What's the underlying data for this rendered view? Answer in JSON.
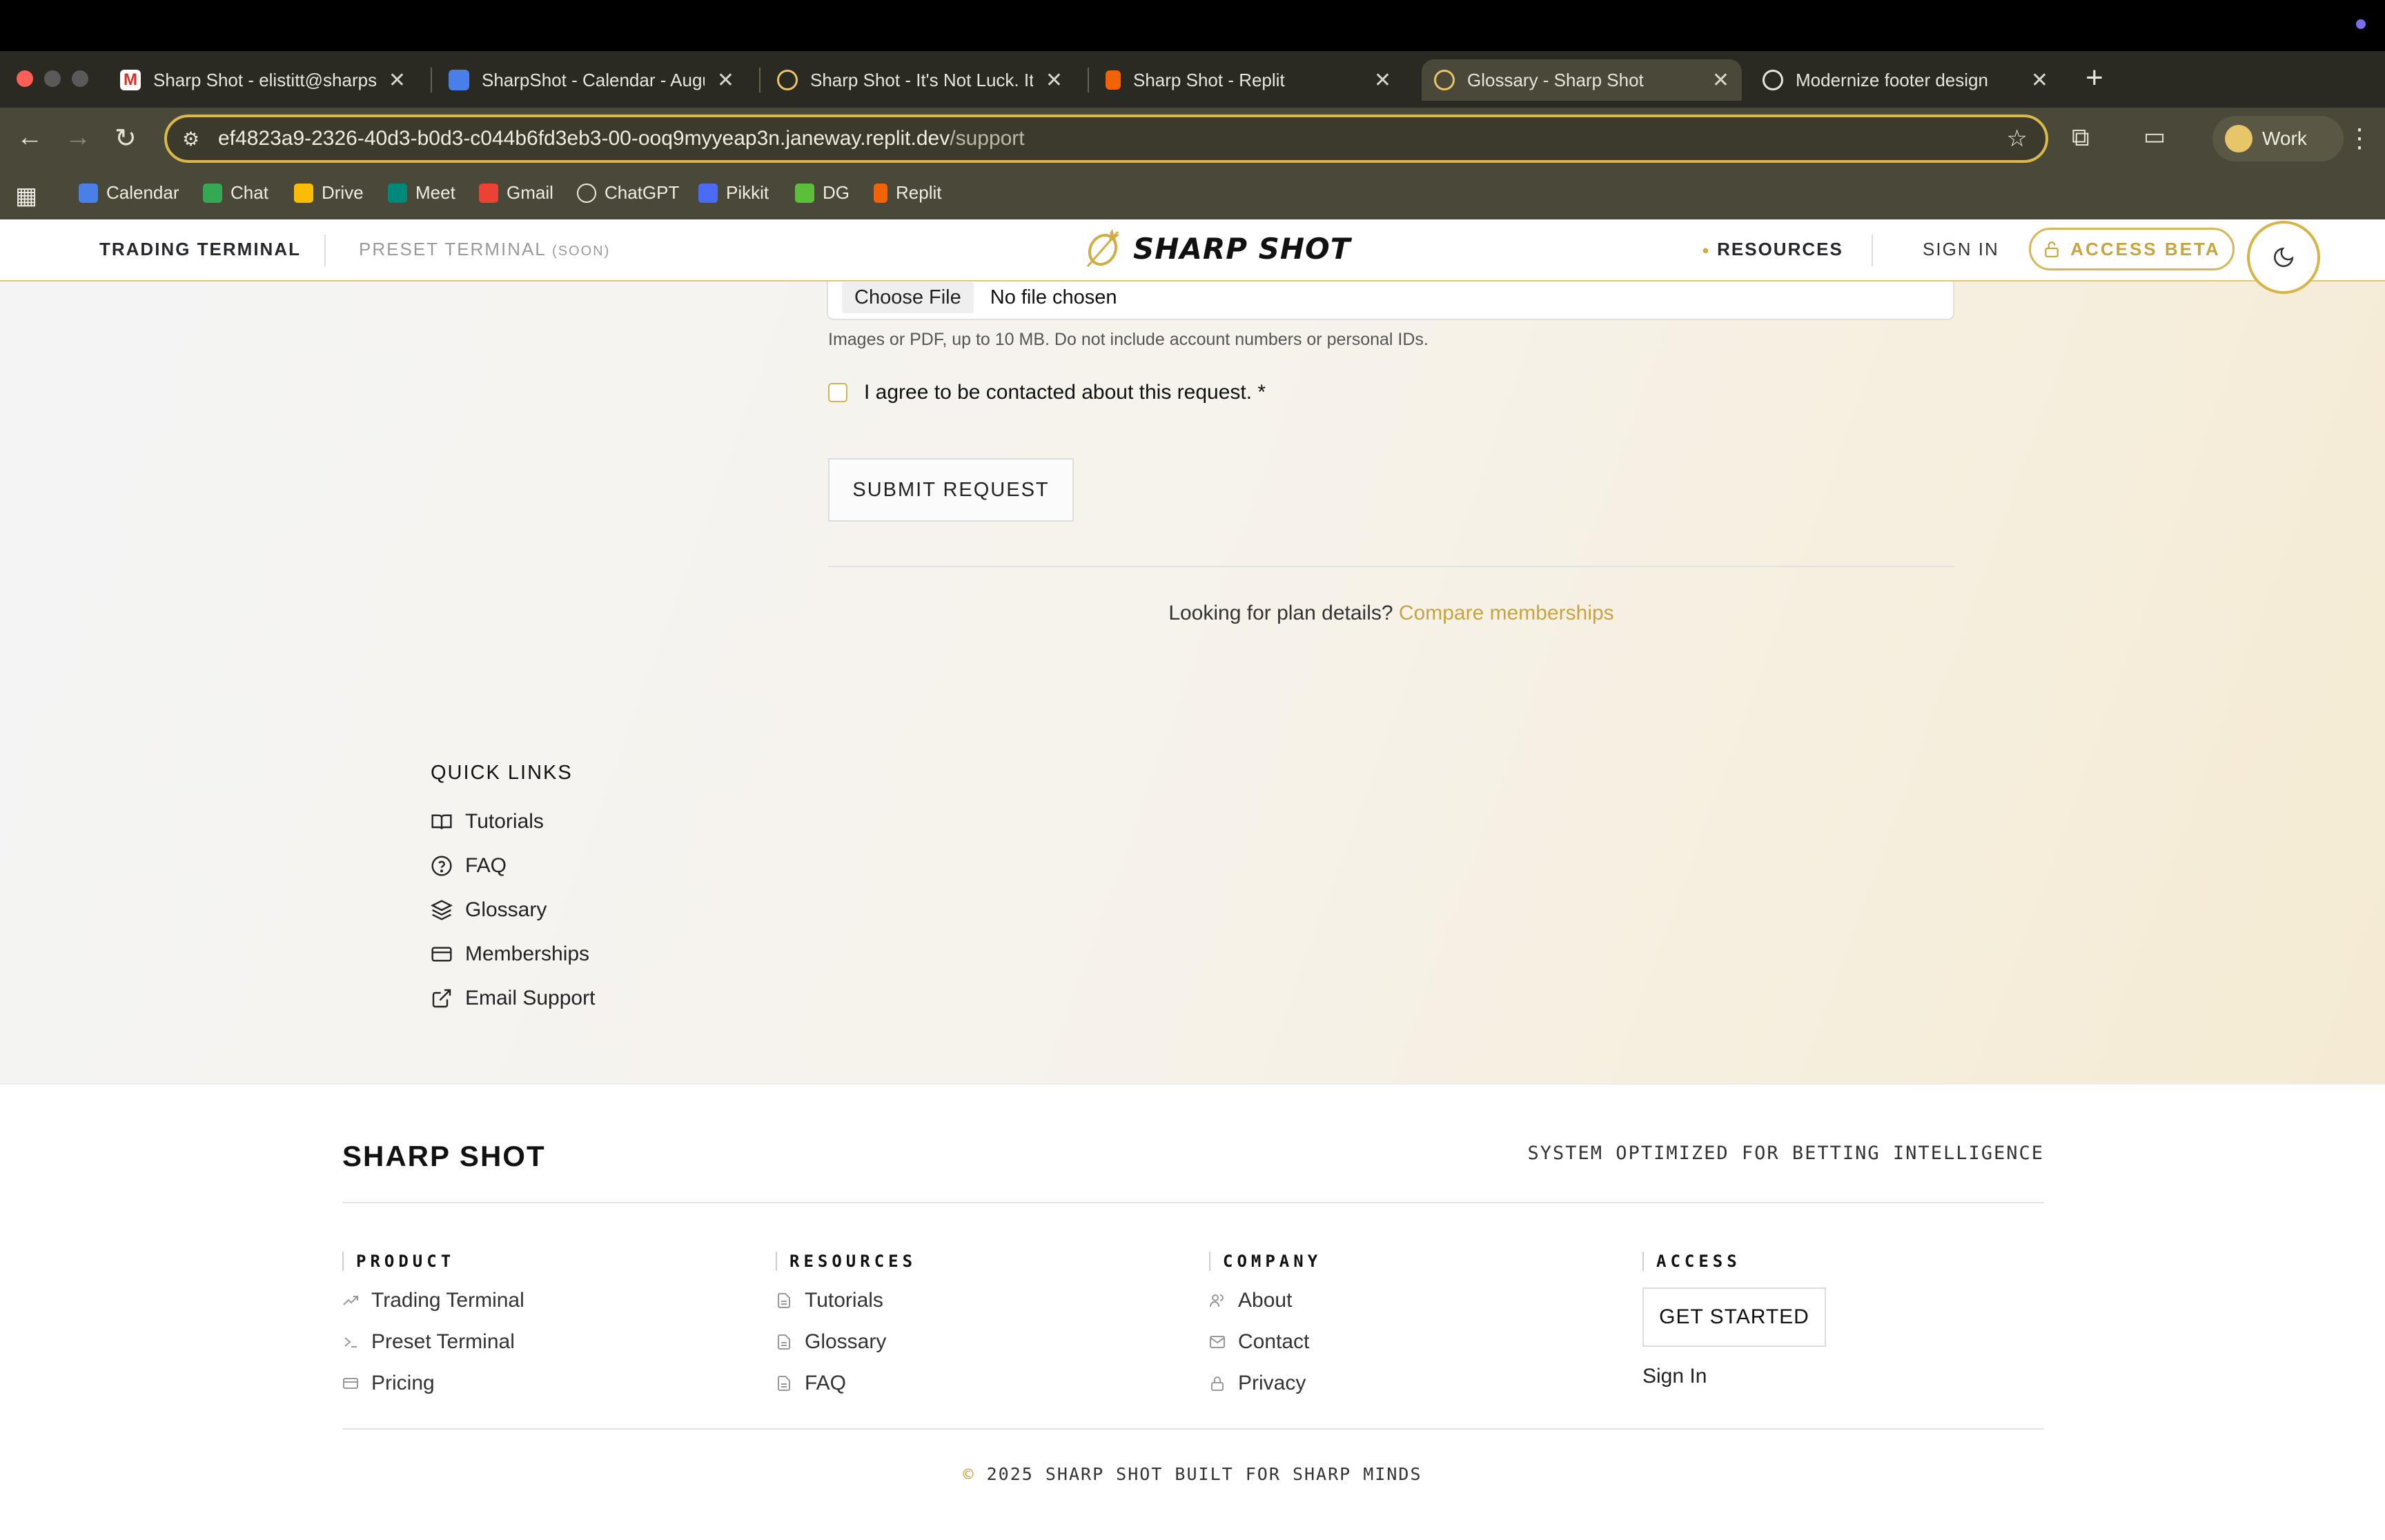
{
  "browser": {
    "tabs": [
      {
        "title": "Sharp Shot - elistitt@sharpsh",
        "icon": "gmail-icon"
      },
      {
        "title": "SharpShot - Calendar - Augu",
        "icon": "calendar-icon"
      },
      {
        "title": "Sharp Shot - It's Not Luck. It'",
        "icon": "sharpshot-icon"
      },
      {
        "title": "Sharp Shot - Replit",
        "icon": "replit-icon"
      },
      {
        "title": "Glossary - Sharp Shot",
        "icon": "sharpshot-icon"
      },
      {
        "title": "Modernize footer design",
        "icon": "chatgpt-icon"
      }
    ],
    "url_host": "ef4823a9-2326-40d3-b0d3-c044b6fd3eb3-00-ooq9myyeap3n.janeway.replit.dev",
    "url_path": "/support",
    "profile": "Work",
    "bookmarks": [
      "Calendar",
      "Chat",
      "Drive",
      "Meet",
      "Gmail",
      "ChatGPT",
      "Pikkit",
      "DG",
      "Replit"
    ]
  },
  "header": {
    "nav_trading": "TRADING TERMINAL",
    "nav_preset": "PRESET TERMINAL",
    "nav_preset_soon": "(SOON)",
    "logo": "SHARP SHOT",
    "resources": "RESOURCES",
    "sign_in": "SIGN IN",
    "access_beta": "ACCESS BETA"
  },
  "form": {
    "choose_file": "Choose File",
    "no_file": "No file chosen",
    "hint": "Images or PDF, up to 10 MB. Do not include account numbers or personal IDs.",
    "agree": "I agree to be contacted about this request. *",
    "submit": "SUBMIT REQUEST",
    "plan_text": "Looking for plan details?",
    "plan_link": "Compare memberships"
  },
  "quick_links": {
    "title": "QUICK LINKS",
    "items": [
      "Tutorials",
      "FAQ",
      "Glossary",
      "Memberships",
      "Email Support"
    ]
  },
  "footer": {
    "brand": "SHARP SHOT",
    "tagline": "SYSTEM OPTIMIZED FOR BETTING INTELLIGENCE",
    "product": {
      "title": "PRODUCT",
      "items": [
        "Trading Terminal",
        "Preset Terminal",
        "Pricing"
      ]
    },
    "resources": {
      "title": "RESOURCES",
      "items": [
        "Tutorials",
        "Glossary",
        "FAQ"
      ]
    },
    "company": {
      "title": "COMPANY",
      "items": [
        "About",
        "Contact",
        "Privacy"
      ]
    },
    "access": {
      "title": "ACCESS",
      "get_started": "GET STARTED",
      "sign_in": "Sign In"
    },
    "copyright_symbol": "©",
    "copyright": "2025 SHARP SHOT BUILT FOR SHARP MINDS"
  },
  "colors": {
    "accent": "#c9a43e",
    "accent_border": "#d6b657",
    "browser_frame": "#4a4838"
  }
}
